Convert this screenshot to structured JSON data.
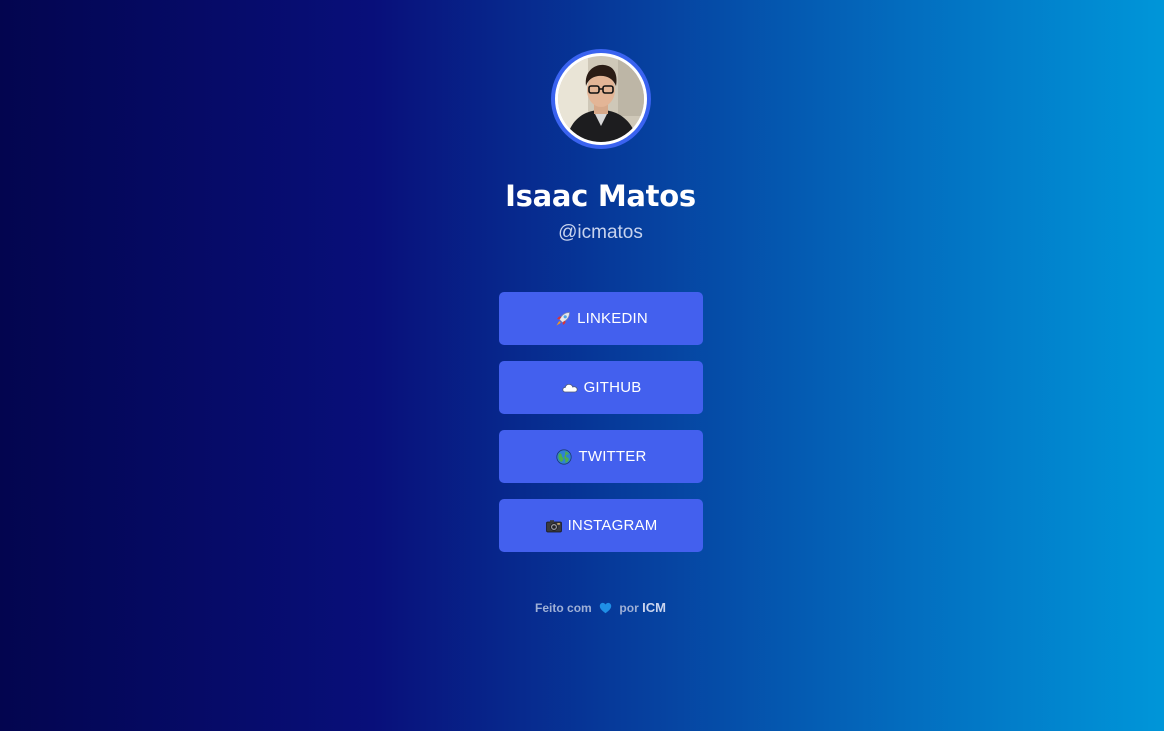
{
  "profile": {
    "name": "Isaac Matos",
    "handle": "@icmatos",
    "avatar_icon": "profile-photo"
  },
  "links": [
    {
      "label": "LINKEDIN",
      "icon": "rocket-icon"
    },
    {
      "label": "GITHUB",
      "icon": "cloud-icon"
    },
    {
      "label": "TWITTER",
      "icon": "globe-icon"
    },
    {
      "label": "INSTAGRAM",
      "icon": "camera-icon"
    }
  ],
  "footer": {
    "prefix": "Feito com",
    "heart_icon": "blue-heart-icon",
    "middle": "por",
    "brand": "ICM"
  },
  "colors": {
    "button": "#4360ee",
    "avatar_ring": "#3a63f0",
    "gradient_start": "#03054f",
    "gradient_end": "#0096d9"
  }
}
